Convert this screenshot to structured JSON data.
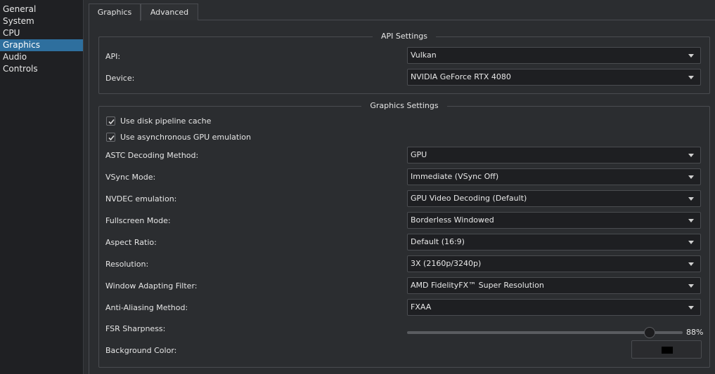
{
  "sidebar": {
    "items": [
      {
        "label": "General"
      },
      {
        "label": "System"
      },
      {
        "label": "CPU"
      },
      {
        "label": "Graphics"
      },
      {
        "label": "Audio"
      },
      {
        "label": "Controls"
      }
    ],
    "selected": "Graphics"
  },
  "tabs": [
    {
      "label": "Graphics"
    },
    {
      "label": "Advanced"
    }
  ],
  "api_settings": {
    "title": "API Settings",
    "api_label": "API:",
    "api_value": "Vulkan",
    "device_label": "Device:",
    "device_value": "NVIDIA GeForce RTX 4080"
  },
  "graphics_settings": {
    "title": "Graphics Settings",
    "disk_cache_label": "Use disk pipeline cache",
    "disk_cache_checked": true,
    "async_gpu_label": "Use asynchronous GPU emulation",
    "async_gpu_checked": true,
    "rows": [
      {
        "label": "ASTC Decoding Method:",
        "value": "GPU"
      },
      {
        "label": "VSync Mode:",
        "value": "Immediate (VSync Off)"
      },
      {
        "label": "NVDEC emulation:",
        "value": "GPU Video Decoding (Default)"
      },
      {
        "label": "Fullscreen Mode:",
        "value": "Borderless Windowed"
      },
      {
        "label": "Aspect Ratio:",
        "value": "Default (16:9)"
      },
      {
        "label": "Resolution:",
        "value": "3X (2160p/3240p)"
      },
      {
        "label": "Window Adapting Filter:",
        "value": "AMD FidelityFX™ Super Resolution"
      },
      {
        "label": "Anti-Aliasing Method:",
        "value": "FXAA"
      }
    ],
    "fsr_label": "FSR Sharpness:",
    "fsr_value_text": "88%",
    "fsr_fraction": 0.88,
    "bg_color_label": "Background Color:",
    "bg_color_value": "#000000"
  },
  "colors": {
    "accent": "#2e6f9e",
    "background": "#2b2d30",
    "sidebar_bg": "#1f2023"
  }
}
